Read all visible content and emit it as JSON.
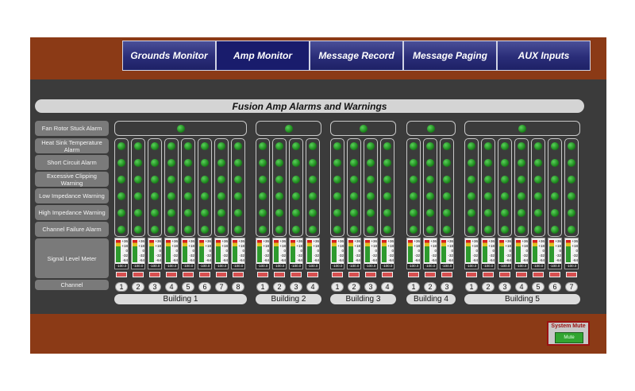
{
  "nav": {
    "tabs": [
      {
        "label": "Grounds  Monitor",
        "active": false
      },
      {
        "label": "Amp  Monitor",
        "active": true
      },
      {
        "label": "Message  Record",
        "active": false
      },
      {
        "label": "Message  Paging",
        "active": false
      },
      {
        "label": "AUX  Inputs",
        "active": false
      }
    ]
  },
  "title": "Fusion Amp Alarms and Warnings",
  "row_labels": [
    "Fan Rotor Stuck Alarm",
    "Heat Sink Temperature Alarm",
    "Short Circuit Alarm",
    "Excessive Clipping Warning",
    "Low Impedance Warning",
    "High Impedance Warning",
    "Channel Failure Alarm",
    "Signal Level Meter",
    "Channel"
  ],
  "meter": {
    "ticks": [
      "+36",
      "+18",
      "0",
      "-32",
      "-64"
    ],
    "value": "-100.0"
  },
  "buildings": [
    {
      "name": "Building  1",
      "channels": [
        "1",
        "2",
        "3",
        "4",
        "5",
        "6",
        "7",
        "8"
      ]
    },
    {
      "name": "Building  2",
      "channels": [
        "1",
        "2",
        "3",
        "4"
      ]
    },
    {
      "name": "Building  3",
      "channels": [
        "1",
        "2",
        "3",
        "4"
      ]
    },
    {
      "name": "Building  4",
      "channels": [
        "1",
        "2",
        "3"
      ]
    },
    {
      "name": "Building  5",
      "channels": [
        "1",
        "2",
        "3",
        "4",
        "5",
        "6",
        "7"
      ]
    }
  ],
  "system_mute": {
    "title": "System Mute",
    "button_label": "Mute"
  },
  "colors": {
    "led_ok": "#2e9a2e",
    "active_tab": "#191c6c",
    "frame": "#8b3a16",
    "panel": "#3b3b3b"
  }
}
